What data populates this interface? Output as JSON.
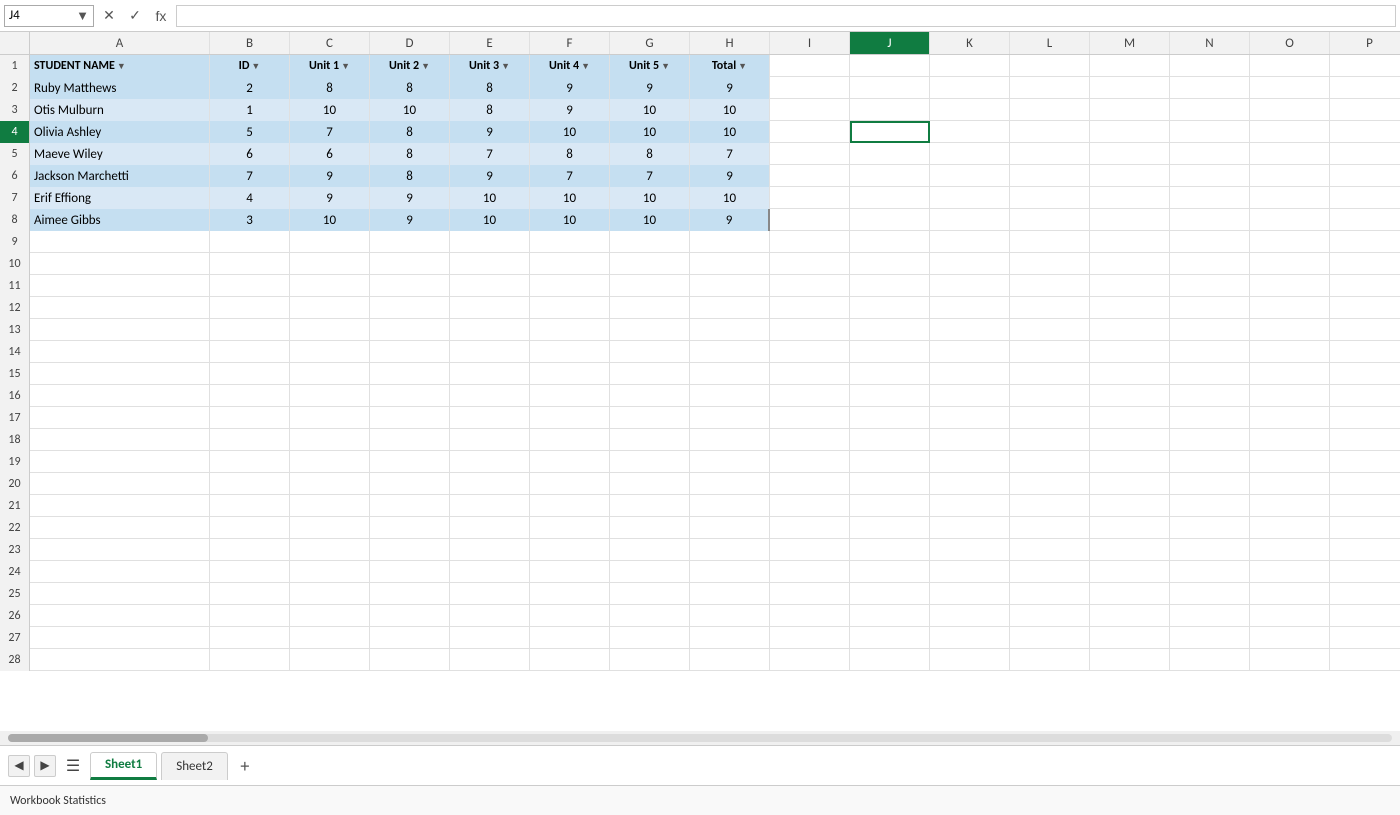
{
  "formula_bar": {
    "name_box": "J4",
    "cancel_label": "✕",
    "confirm_label": "✓",
    "fx_label": "fx",
    "formula_value": ""
  },
  "columns": [
    {
      "id": "A",
      "label": "A",
      "class": "col-a"
    },
    {
      "id": "B",
      "label": "B",
      "class": "col-b"
    },
    {
      "id": "C",
      "label": "C",
      "class": "col-c"
    },
    {
      "id": "D",
      "label": "D",
      "class": "col-d"
    },
    {
      "id": "E",
      "label": "E",
      "class": "col-e"
    },
    {
      "id": "F",
      "label": "F",
      "class": "col-f"
    },
    {
      "id": "G",
      "label": "G",
      "class": "col-g"
    },
    {
      "id": "H",
      "label": "H",
      "class": "col-h"
    },
    {
      "id": "I",
      "label": "I",
      "class": "col-i"
    },
    {
      "id": "J",
      "label": "J",
      "class": "col-j"
    },
    {
      "id": "K",
      "label": "K",
      "class": "col-k"
    },
    {
      "id": "L",
      "label": "L",
      "class": "col-l"
    },
    {
      "id": "M",
      "label": "M",
      "class": "col-m"
    },
    {
      "id": "N",
      "label": "N",
      "class": "col-n"
    },
    {
      "id": "O",
      "label": "O",
      "class": "col-o"
    },
    {
      "id": "P",
      "label": "P",
      "class": "col-p"
    }
  ],
  "header_row": {
    "row_num": "1",
    "cells": [
      {
        "col": "A",
        "value": "STUDENT NAME",
        "has_filter": true,
        "align": "left"
      },
      {
        "col": "B",
        "value": "ID",
        "has_filter": true,
        "align": "left"
      },
      {
        "col": "C",
        "value": "Unit 1",
        "has_filter": true,
        "align": "center"
      },
      {
        "col": "D",
        "value": "Unit 2",
        "has_filter": true,
        "align": "center"
      },
      {
        "col": "E",
        "value": "Unit 3",
        "has_filter": true,
        "align": "center"
      },
      {
        "col": "F",
        "value": "Unit 4",
        "has_filter": true,
        "align": "center"
      },
      {
        "col": "G",
        "value": "Unit 5",
        "has_filter": true,
        "align": "center"
      },
      {
        "col": "H",
        "value": "Total",
        "has_filter": true,
        "align": "center"
      },
      {
        "col": "I",
        "value": "",
        "has_filter": false,
        "align": "center"
      },
      {
        "col": "J",
        "value": "",
        "has_filter": false,
        "align": "center"
      },
      {
        "col": "K",
        "value": "",
        "has_filter": false,
        "align": "center"
      },
      {
        "col": "L",
        "value": "",
        "has_filter": false,
        "align": "center"
      },
      {
        "col": "M",
        "value": "",
        "has_filter": false,
        "align": "center"
      },
      {
        "col": "N",
        "value": "",
        "has_filter": false,
        "align": "center"
      },
      {
        "col": "O",
        "value": "",
        "has_filter": false,
        "align": "center"
      },
      {
        "col": "P",
        "value": "",
        "has_filter": false,
        "align": "center"
      }
    ]
  },
  "data_rows": [
    {
      "row_num": "2",
      "style": "odd",
      "cells": [
        {
          "col": "A",
          "value": "Ruby Matthews",
          "align": "left"
        },
        {
          "col": "B",
          "value": "2",
          "align": "center"
        },
        {
          "col": "C",
          "value": "8",
          "align": "center"
        },
        {
          "col": "D",
          "value": "8",
          "align": "center"
        },
        {
          "col": "E",
          "value": "8",
          "align": "center"
        },
        {
          "col": "F",
          "value": "9",
          "align": "center"
        },
        {
          "col": "G",
          "value": "9",
          "align": "center"
        },
        {
          "col": "H",
          "value": "9",
          "align": "center"
        },
        {
          "col": "I",
          "value": "",
          "align": "center"
        },
        {
          "col": "J",
          "value": "",
          "align": "center"
        },
        {
          "col": "K",
          "value": "",
          "align": "center"
        },
        {
          "col": "L",
          "value": "",
          "align": "center"
        },
        {
          "col": "M",
          "value": "",
          "align": "center"
        },
        {
          "col": "N",
          "value": "",
          "align": "center"
        },
        {
          "col": "O",
          "value": "",
          "align": "center"
        },
        {
          "col": "P",
          "value": "",
          "align": "center"
        }
      ]
    },
    {
      "row_num": "3",
      "style": "even",
      "cells": [
        {
          "col": "A",
          "value": "Otis Mulburn",
          "align": "left"
        },
        {
          "col": "B",
          "value": "1",
          "align": "center"
        },
        {
          "col": "C",
          "value": "10",
          "align": "center"
        },
        {
          "col": "D",
          "value": "10",
          "align": "center"
        },
        {
          "col": "E",
          "value": "8",
          "align": "center"
        },
        {
          "col": "F",
          "value": "9",
          "align": "center"
        },
        {
          "col": "G",
          "value": "10",
          "align": "center"
        },
        {
          "col": "H",
          "value": "10",
          "align": "center"
        },
        {
          "col": "I",
          "value": "",
          "align": "center"
        },
        {
          "col": "J",
          "value": "",
          "align": "center"
        },
        {
          "col": "K",
          "value": "",
          "align": "center"
        },
        {
          "col": "L",
          "value": "",
          "align": "center"
        },
        {
          "col": "M",
          "value": "",
          "align": "center"
        },
        {
          "col": "N",
          "value": "",
          "align": "center"
        },
        {
          "col": "O",
          "value": "",
          "align": "center"
        },
        {
          "col": "P",
          "value": "",
          "align": "center"
        }
      ]
    },
    {
      "row_num": "4",
      "style": "odd",
      "cells": [
        {
          "col": "A",
          "value": "Olivia Ashley",
          "align": "left"
        },
        {
          "col": "B",
          "value": "5",
          "align": "center"
        },
        {
          "col": "C",
          "value": "7",
          "align": "center"
        },
        {
          "col": "D",
          "value": "8",
          "align": "center"
        },
        {
          "col": "E",
          "value": "9",
          "align": "center"
        },
        {
          "col": "F",
          "value": "10",
          "align": "center"
        },
        {
          "col": "G",
          "value": "10",
          "align": "center"
        },
        {
          "col": "H",
          "value": "10",
          "align": "center"
        },
        {
          "col": "I",
          "value": "",
          "align": "center"
        },
        {
          "col": "J",
          "value": "",
          "align": "center",
          "selected": true
        },
        {
          "col": "K",
          "value": "",
          "align": "center"
        },
        {
          "col": "L",
          "value": "",
          "align": "center"
        },
        {
          "col": "M",
          "value": "",
          "align": "center"
        },
        {
          "col": "N",
          "value": "",
          "align": "center"
        },
        {
          "col": "O",
          "value": "",
          "align": "center"
        },
        {
          "col": "P",
          "value": "",
          "align": "center"
        }
      ]
    },
    {
      "row_num": "5",
      "style": "even",
      "cells": [
        {
          "col": "A",
          "value": "Maeve Wiley",
          "align": "left"
        },
        {
          "col": "B",
          "value": "6",
          "align": "center"
        },
        {
          "col": "C",
          "value": "6",
          "align": "center"
        },
        {
          "col": "D",
          "value": "8",
          "align": "center"
        },
        {
          "col": "E",
          "value": "7",
          "align": "center"
        },
        {
          "col": "F",
          "value": "8",
          "align": "center"
        },
        {
          "col": "G",
          "value": "8",
          "align": "center"
        },
        {
          "col": "H",
          "value": "7",
          "align": "center"
        },
        {
          "col": "I",
          "value": "",
          "align": "center"
        },
        {
          "col": "J",
          "value": "",
          "align": "center"
        },
        {
          "col": "K",
          "value": "",
          "align": "center"
        },
        {
          "col": "L",
          "value": "",
          "align": "center"
        },
        {
          "col": "M",
          "value": "",
          "align": "center"
        },
        {
          "col": "N",
          "value": "",
          "align": "center"
        },
        {
          "col": "O",
          "value": "",
          "align": "center"
        },
        {
          "col": "P",
          "value": "",
          "align": "center"
        }
      ]
    },
    {
      "row_num": "6",
      "style": "odd",
      "cells": [
        {
          "col": "A",
          "value": "Jackson Marchetti",
          "align": "left"
        },
        {
          "col": "B",
          "value": "7",
          "align": "center"
        },
        {
          "col": "C",
          "value": "9",
          "align": "center"
        },
        {
          "col": "D",
          "value": "8",
          "align": "center"
        },
        {
          "col": "E",
          "value": "9",
          "align": "center"
        },
        {
          "col": "F",
          "value": "7",
          "align": "center"
        },
        {
          "col": "G",
          "value": "7",
          "align": "center"
        },
        {
          "col": "H",
          "value": "9",
          "align": "center"
        },
        {
          "col": "I",
          "value": "",
          "align": "center"
        },
        {
          "col": "J",
          "value": "",
          "align": "center"
        },
        {
          "col": "K",
          "value": "",
          "align": "center"
        },
        {
          "col": "L",
          "value": "",
          "align": "center"
        },
        {
          "col": "M",
          "value": "",
          "align": "center"
        },
        {
          "col": "N",
          "value": "",
          "align": "center"
        },
        {
          "col": "O",
          "value": "",
          "align": "center"
        },
        {
          "col": "P",
          "value": "",
          "align": "center"
        }
      ]
    },
    {
      "row_num": "7",
      "style": "even",
      "cells": [
        {
          "col": "A",
          "value": "Erif Effiong",
          "align": "left"
        },
        {
          "col": "B",
          "value": "4",
          "align": "center"
        },
        {
          "col": "C",
          "value": "9",
          "align": "center"
        },
        {
          "col": "D",
          "value": "9",
          "align": "center"
        },
        {
          "col": "E",
          "value": "10",
          "align": "center"
        },
        {
          "col": "F",
          "value": "10",
          "align": "center"
        },
        {
          "col": "G",
          "value": "10",
          "align": "center"
        },
        {
          "col": "H",
          "value": "10",
          "align": "center"
        },
        {
          "col": "I",
          "value": "",
          "align": "center"
        },
        {
          "col": "J",
          "value": "",
          "align": "center"
        },
        {
          "col": "K",
          "value": "",
          "align": "center"
        },
        {
          "col": "L",
          "value": "",
          "align": "center"
        },
        {
          "col": "M",
          "value": "",
          "align": "center"
        },
        {
          "col": "N",
          "value": "",
          "align": "center"
        },
        {
          "col": "O",
          "value": "",
          "align": "center"
        },
        {
          "col": "P",
          "value": "",
          "align": "center"
        }
      ]
    },
    {
      "row_num": "8",
      "style": "odd",
      "cells": [
        {
          "col": "A",
          "value": "Aimee Gibbs",
          "align": "left"
        },
        {
          "col": "B",
          "value": "3",
          "align": "center"
        },
        {
          "col": "C",
          "value": "10",
          "align": "center"
        },
        {
          "col": "D",
          "value": "9",
          "align": "center"
        },
        {
          "col": "E",
          "value": "10",
          "align": "center"
        },
        {
          "col": "F",
          "value": "10",
          "align": "center"
        },
        {
          "col": "G",
          "value": "10",
          "align": "center"
        },
        {
          "col": "H",
          "value": "9",
          "align": "center"
        },
        {
          "col": "I",
          "value": "",
          "align": "center"
        },
        {
          "col": "J",
          "value": "",
          "align": "center"
        },
        {
          "col": "K",
          "value": "",
          "align": "center"
        },
        {
          "col": "L",
          "value": "",
          "align": "center"
        },
        {
          "col": "M",
          "value": "",
          "align": "center"
        },
        {
          "col": "N",
          "value": "",
          "align": "center"
        },
        {
          "col": "O",
          "value": "",
          "align": "center"
        },
        {
          "col": "P",
          "value": "",
          "align": "center"
        }
      ]
    }
  ],
  "empty_rows": [
    "9",
    "10",
    "11",
    "12",
    "13",
    "14",
    "15",
    "16",
    "17",
    "18",
    "19",
    "20",
    "21",
    "22",
    "23",
    "24",
    "25",
    "26",
    "27",
    "28"
  ],
  "sheets": [
    {
      "label": "Sheet1",
      "active": true
    },
    {
      "label": "Sheet2",
      "active": false
    }
  ],
  "status_bar": {
    "text": "Workbook Statistics"
  },
  "colors": {
    "green_accent": "#107c41",
    "row_odd": "#c5dff1",
    "row_even": "#d9e8f5",
    "header_bg": "#c5dff1",
    "selected_outline": "#107c41"
  }
}
